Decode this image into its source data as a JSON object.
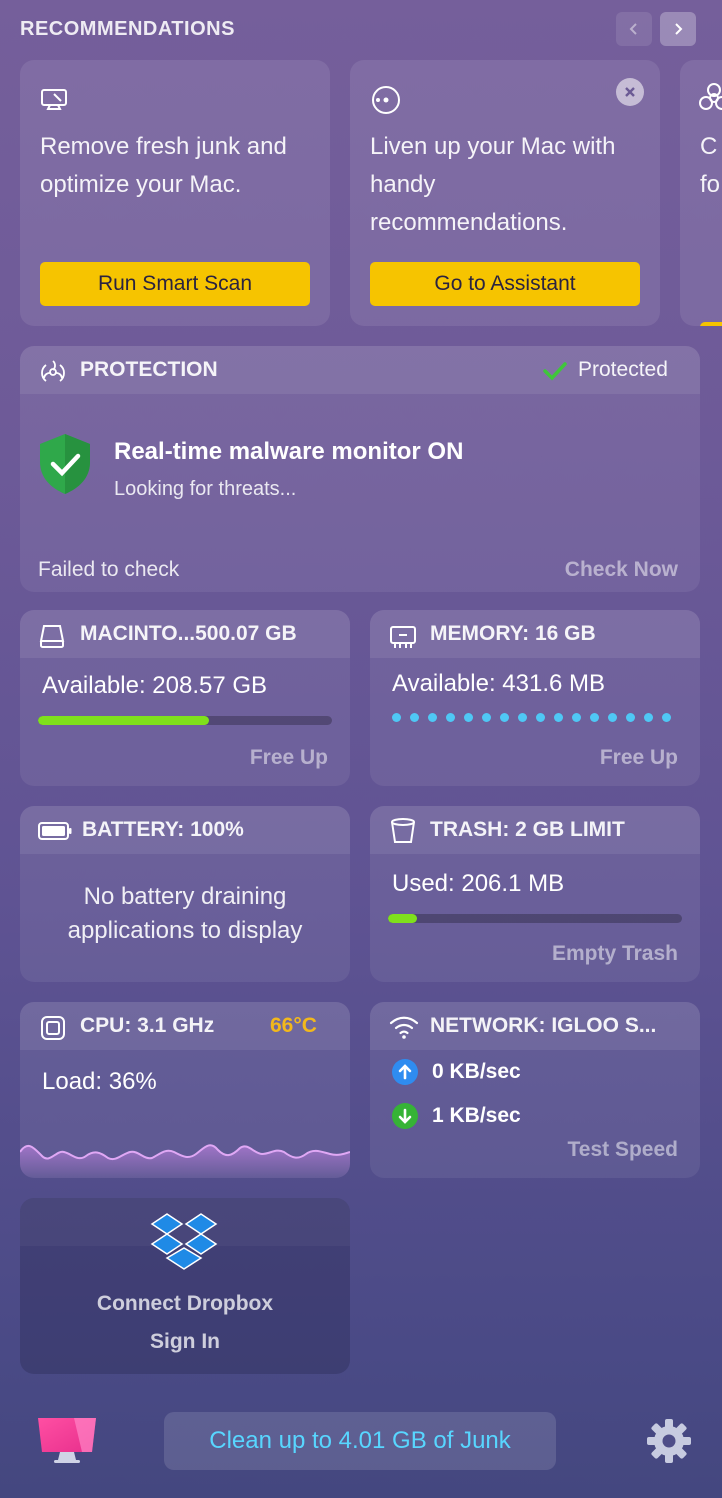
{
  "header": {
    "title": "RECOMMENDATIONS"
  },
  "recommendations": [
    {
      "text": "Remove fresh junk and optimize your Mac.",
      "button": "Run Smart Scan",
      "icon": "monitor-icon"
    },
    {
      "text": "Liven up your Mac with handy recommendations.",
      "button": "Go to Assistant",
      "icon": "assistant-icon"
    },
    {
      "text": "C\nfo",
      "icon": "biohazard-icon"
    }
  ],
  "protection": {
    "title": "PROTECTION",
    "status": "Protected",
    "headline": "Real-time malware monitor ON",
    "subtext": "Looking for threats...",
    "check_status": "Failed to check",
    "action": "Check Now"
  },
  "disk": {
    "title": "MACINTO...500.07 GB",
    "available": "Available: 208.57 GB",
    "used_fraction": 0.58,
    "action": "Free Up"
  },
  "memory": {
    "title": "MEMORY: 16 GB",
    "available": "Available: 431.6 MB",
    "action": "Free Up"
  },
  "battery": {
    "title": "BATTERY: 100%",
    "message": "No battery draining applications to display"
  },
  "trash": {
    "title": "TRASH: 2 GB LIMIT",
    "used": "Used: 206.1 MB",
    "used_fraction": 0.1,
    "action": "Empty Trash"
  },
  "cpu": {
    "title": "CPU: 3.1 GHz",
    "temperature": "66°C",
    "load": "Load: 36%"
  },
  "network": {
    "title": "NETWORK: IGLOO S...",
    "upload": "0 KB/sec",
    "download": "1 KB/sec",
    "action": "Test Speed"
  },
  "dropbox": {
    "title": "Connect Dropbox",
    "action": "Sign In"
  },
  "footer": {
    "clean_button": "Clean up to 4.01 GB of Junk"
  },
  "colors": {
    "accent_yellow": "#f6c400",
    "bar_green": "#7fe01c",
    "memory_dots": "#4fc8f5",
    "temperature": "#f2b81c",
    "link_blue": "#58d6ff"
  }
}
